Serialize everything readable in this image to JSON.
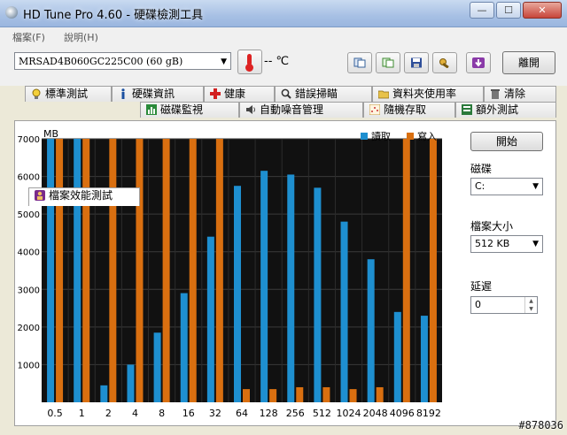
{
  "window": {
    "title": "HD Tune Pro 4.60 - 硬碟檢測工具",
    "controls": {
      "minimize": "—",
      "maximize": "☐",
      "close": "✕"
    }
  },
  "menu": [
    "檔案(F)",
    "說明(H)"
  ],
  "toolbar": {
    "drive": "MRSAD4B060GC225C00   (60 gB)",
    "temperature": "-- ℃",
    "exit_label": "離開"
  },
  "tabs_top": [
    "標準測試",
    "硬碟資訊",
    "健康",
    "錯誤掃瞄",
    "資料夾使用率",
    "清除"
  ],
  "tabs_bottom": [
    "檔案效能測試",
    "磁碟監視",
    "自動噪音管理",
    "隨機存取",
    "額外測試"
  ],
  "active_tab": "檔案效能測試",
  "panel": {
    "start_label": "開始",
    "disk_label": "磁碟",
    "disk_value": "C:",
    "file_size_label": "檔案大小",
    "file_size_value": "512 KB",
    "delay_label": "延遲",
    "delay_value": "0"
  },
  "colors": {
    "read": "#1e8fd0",
    "write": "#d96f10",
    "plot_bg": "#111111"
  },
  "chart_data": {
    "type": "bar",
    "ylabel_fragment": "MB",
    "ytick_fragments": [
      "7000",
      "6000",
      "5000",
      "4000",
      "3000",
      "2000",
      "1000"
    ],
    "categories": [
      "0.5",
      "1",
      "2",
      "4",
      "8",
      "16",
      "32",
      "64",
      "128",
      "256",
      "512",
      "1024",
      "2048",
      "4096",
      "8192"
    ],
    "ylim": [
      0,
      7000
    ],
    "legend": "top-right",
    "grid": true,
    "series": [
      {
        "name": "讀取",
        "values": [
          7500,
          7500,
          450,
          1000,
          1850,
          2900,
          4400,
          5750,
          6150,
          6050,
          5700,
          4800,
          3800,
          2400,
          2300
        ]
      },
      {
        "name": "寫入",
        "values": [
          7500,
          7500,
          7500,
          7500,
          7500,
          7500,
          7500,
          350,
          350,
          400,
          400,
          350,
          400,
          7500,
          7500
        ]
      }
    ]
  },
  "watermark": "#878036"
}
